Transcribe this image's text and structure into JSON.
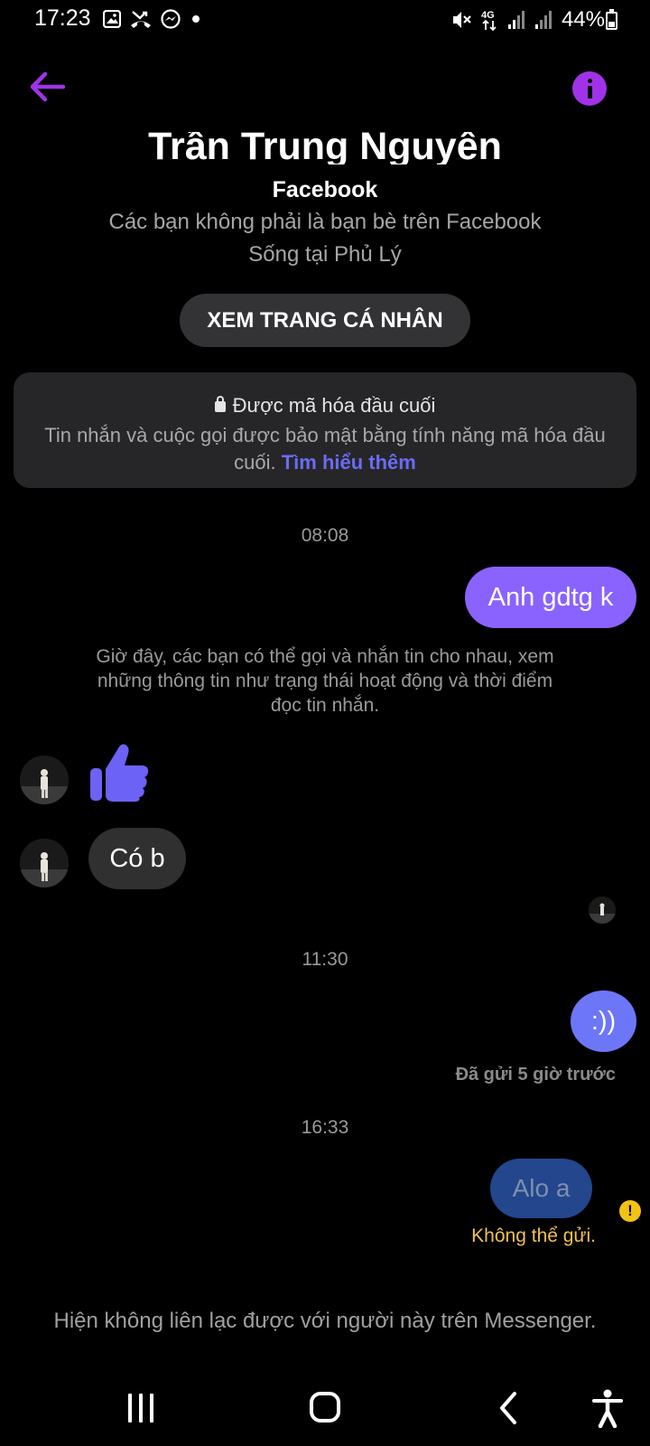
{
  "status_bar": {
    "time": "17:23",
    "battery": "44%",
    "network": "4G",
    "left_icons": [
      "image-icon",
      "missed-call-icon",
      "messenger-icon",
      "dot-icon"
    ],
    "right_icons": [
      "mute-icon",
      "4g-icon",
      "signal-icon",
      "signal-icon",
      "battery-icon"
    ]
  },
  "header": {
    "back_icon": "back-arrow-icon",
    "info_icon": "info-icon",
    "accent_color": "#a033e8"
  },
  "profile": {
    "name": "Trần Trung Nguyên",
    "platform": "Facebook",
    "friend_status": "Các bạn không phải là bạn bè trên Facebook",
    "location": "Sống tại Phủ Lý",
    "view_profile_label": "XEM TRANG CÁ NHÂN"
  },
  "encryption": {
    "title": "Được mã hóa đầu cuối",
    "description": "Tin nhắn và cuộc gọi được bảo mật bằng tính năng mã hóa đầu cuối.",
    "link": "Tìm hiểu thêm"
  },
  "conversation": {
    "time_1": "08:08",
    "msg_out_1": "Anh gdtg k",
    "system_note": "Giờ đây, các bạn có thể gọi và nhắn tin cho nhau, xem những thông tin như trạng thái hoạt động và thời điểm đọc tin nhắn.",
    "like_icon": "thumbs-up-icon",
    "msg_in_1": "Có b",
    "time_2": "11:30",
    "msg_out_2": ":))",
    "sent_status": "Đã gửi 5 giờ trước",
    "time_3": "16:33",
    "msg_out_failed": "Alo a",
    "failed_text": "Không thể gửi.",
    "outgoing_bubble_color": "#8a63ff",
    "failed_color": "#f2c14e"
  },
  "footer": {
    "unavailable_text": "Hiện không liên lạc được với người này trên Messenger."
  },
  "nav_bar": {
    "icons": [
      "recents-icon",
      "home-icon",
      "back-icon",
      "accessibility-icon"
    ]
  }
}
